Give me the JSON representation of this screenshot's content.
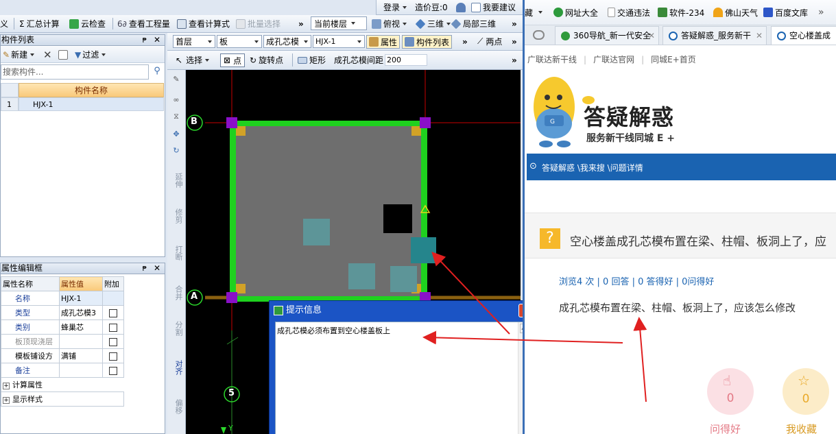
{
  "app": {
    "top_bar": {
      "login": "登录",
      "price_label": "造价豆:0",
      "suggest": "我要建议"
    },
    "toolbar1": {
      "left_cut": "义",
      "summary": "汇总计算",
      "cloud_check": "云检查",
      "view_quantity": "查看工程量",
      "view_formula": "查看计算式",
      "batch_select": "批量选择",
      "more": "»",
      "floor_select": "当前楼层",
      "top_view": "俯视",
      "three_d": "三维",
      "local_three_d": "局部三维"
    },
    "toolbar2": {
      "floor": "首层",
      "type": "板",
      "category": "成孔芯模",
      "item": "HJX-1",
      "properties_btn": "属性",
      "component_list_btn": "构件列表",
      "more": "»",
      "two_points": "两点"
    },
    "toolbar3": {
      "select": "选择",
      "point": "点",
      "rotate_point": "旋转点",
      "rect": "矩形",
      "spacing_label": "成孔芯模间距",
      "spacing_value": "200",
      "more": "»"
    },
    "component_list": {
      "title": "构件列表",
      "new_btn": "新建",
      "filter_btn": "过滤",
      "search_placeholder": "搜索构件...",
      "col_header": "构件名称",
      "rows": [
        {
          "index": "1",
          "name": "HJX-1"
        }
      ]
    },
    "property_panel": {
      "title": "属性编辑框",
      "headers": [
        "属性名称",
        "属性值",
        "附加"
      ],
      "rows": [
        {
          "name": "名称",
          "value": "HJX-1",
          "check": false,
          "blue": true
        },
        {
          "name": "类型",
          "value": "成孔芯模3",
          "check": true,
          "blue": true
        },
        {
          "name": "类别",
          "value": "蜂巢芯",
          "check": true,
          "blue": true
        },
        {
          "name": "板顶现浇层",
          "value": "",
          "check": true,
          "blue": false,
          "gray": true
        },
        {
          "name": "模板铺设方",
          "value": "满铺",
          "check": true,
          "blue": false
        },
        {
          "name": "备注",
          "value": "",
          "check": true,
          "blue": true
        }
      ],
      "groups": [
        "计算属性",
        "显示样式"
      ]
    },
    "vertical_toolbar": [
      "延伸",
      "修剪",
      "打断",
      "合并",
      "分割",
      "对齐",
      "偏移"
    ],
    "cad": {
      "axis_b": "B",
      "axis_a": "A",
      "axis_5": "5",
      "axis_y": "Y"
    },
    "dialog": {
      "title": "提示信息",
      "message": "成孔芯模必须布置到空心楼盖板上"
    }
  },
  "browser": {
    "bookmarks": [
      "藏",
      "网址大全",
      "交通违法",
      "软件-234",
      "佛山天气",
      "百度文库",
      "»"
    ],
    "tabs": [
      {
        "label": "360导航_新一代安全"
      },
      {
        "label": "答疑解惑_服务新干"
      },
      {
        "label": "空心楼盖成"
      }
    ],
    "site_nav": [
      "广联达新干线",
      "广联达官网",
      "同城E+首页"
    ],
    "logo": {
      "title": "答疑解惑",
      "subtitle": "服务新干线同城 E +"
    },
    "breadcrumb": "答疑解惑 \\我来搜 \\问题详情",
    "question": {
      "title": "空心楼盖成孔芯模布置在梁、柱帽、板洞上了，应",
      "stats": "浏览4 次 | 0 回答 | 0 答得好 | 0问得好",
      "body": "成孔芯模布置在梁、柱帽、板洞上了，应该怎么修改"
    },
    "actions": [
      {
        "count": "0",
        "label": "问得好"
      },
      {
        "count": "0",
        "label": "我收藏"
      }
    ],
    "colors": {
      "nav_blue": "#1a63b1",
      "accent_yellow": "#f6b82a",
      "pink_circle": "#fbe0e4",
      "yellow_circle": "#fcecc8"
    }
  }
}
